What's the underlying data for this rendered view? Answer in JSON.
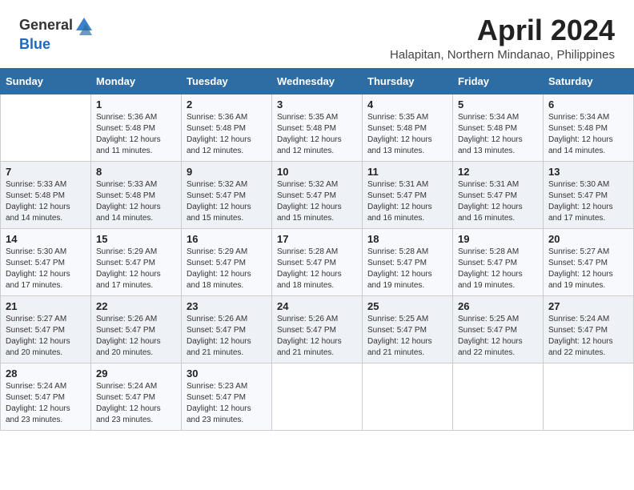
{
  "header": {
    "logo_general": "General",
    "logo_blue": "Blue",
    "title": "April 2024",
    "location": "Halapitan, Northern Mindanao, Philippines"
  },
  "weekdays": [
    "Sunday",
    "Monday",
    "Tuesday",
    "Wednesday",
    "Thursday",
    "Friday",
    "Saturday"
  ],
  "weeks": [
    [
      {
        "date": "",
        "info": ""
      },
      {
        "date": "1",
        "info": "Sunrise: 5:36 AM\nSunset: 5:48 PM\nDaylight: 12 hours and 11 minutes."
      },
      {
        "date": "2",
        "info": "Sunrise: 5:36 AM\nSunset: 5:48 PM\nDaylight: 12 hours and 12 minutes."
      },
      {
        "date": "3",
        "info": "Sunrise: 5:35 AM\nSunset: 5:48 PM\nDaylight: 12 hours and 12 minutes."
      },
      {
        "date": "4",
        "info": "Sunrise: 5:35 AM\nSunset: 5:48 PM\nDaylight: 12 hours and 13 minutes."
      },
      {
        "date": "5",
        "info": "Sunrise: 5:34 AM\nSunset: 5:48 PM\nDaylight: 12 hours and 13 minutes."
      },
      {
        "date": "6",
        "info": "Sunrise: 5:34 AM\nSunset: 5:48 PM\nDaylight: 12 hours and 14 minutes."
      }
    ],
    [
      {
        "date": "7",
        "info": "Sunrise: 5:33 AM\nSunset: 5:48 PM\nDaylight: 12 hours and 14 minutes."
      },
      {
        "date": "8",
        "info": "Sunrise: 5:33 AM\nSunset: 5:48 PM\nDaylight: 12 hours and 14 minutes."
      },
      {
        "date": "9",
        "info": "Sunrise: 5:32 AM\nSunset: 5:47 PM\nDaylight: 12 hours and 15 minutes."
      },
      {
        "date": "10",
        "info": "Sunrise: 5:32 AM\nSunset: 5:47 PM\nDaylight: 12 hours and 15 minutes."
      },
      {
        "date": "11",
        "info": "Sunrise: 5:31 AM\nSunset: 5:47 PM\nDaylight: 12 hours and 16 minutes."
      },
      {
        "date": "12",
        "info": "Sunrise: 5:31 AM\nSunset: 5:47 PM\nDaylight: 12 hours and 16 minutes."
      },
      {
        "date": "13",
        "info": "Sunrise: 5:30 AM\nSunset: 5:47 PM\nDaylight: 12 hours and 17 minutes."
      }
    ],
    [
      {
        "date": "14",
        "info": "Sunrise: 5:30 AM\nSunset: 5:47 PM\nDaylight: 12 hours and 17 minutes."
      },
      {
        "date": "15",
        "info": "Sunrise: 5:29 AM\nSunset: 5:47 PM\nDaylight: 12 hours and 17 minutes."
      },
      {
        "date": "16",
        "info": "Sunrise: 5:29 AM\nSunset: 5:47 PM\nDaylight: 12 hours and 18 minutes."
      },
      {
        "date": "17",
        "info": "Sunrise: 5:28 AM\nSunset: 5:47 PM\nDaylight: 12 hours and 18 minutes."
      },
      {
        "date": "18",
        "info": "Sunrise: 5:28 AM\nSunset: 5:47 PM\nDaylight: 12 hours and 19 minutes."
      },
      {
        "date": "19",
        "info": "Sunrise: 5:28 AM\nSunset: 5:47 PM\nDaylight: 12 hours and 19 minutes."
      },
      {
        "date": "20",
        "info": "Sunrise: 5:27 AM\nSunset: 5:47 PM\nDaylight: 12 hours and 19 minutes."
      }
    ],
    [
      {
        "date": "21",
        "info": "Sunrise: 5:27 AM\nSunset: 5:47 PM\nDaylight: 12 hours and 20 minutes."
      },
      {
        "date": "22",
        "info": "Sunrise: 5:26 AM\nSunset: 5:47 PM\nDaylight: 12 hours and 20 minutes."
      },
      {
        "date": "23",
        "info": "Sunrise: 5:26 AM\nSunset: 5:47 PM\nDaylight: 12 hours and 21 minutes."
      },
      {
        "date": "24",
        "info": "Sunrise: 5:26 AM\nSunset: 5:47 PM\nDaylight: 12 hours and 21 minutes."
      },
      {
        "date": "25",
        "info": "Sunrise: 5:25 AM\nSunset: 5:47 PM\nDaylight: 12 hours and 21 minutes."
      },
      {
        "date": "26",
        "info": "Sunrise: 5:25 AM\nSunset: 5:47 PM\nDaylight: 12 hours and 22 minutes."
      },
      {
        "date": "27",
        "info": "Sunrise: 5:24 AM\nSunset: 5:47 PM\nDaylight: 12 hours and 22 minutes."
      }
    ],
    [
      {
        "date": "28",
        "info": "Sunrise: 5:24 AM\nSunset: 5:47 PM\nDaylight: 12 hours and 23 minutes."
      },
      {
        "date": "29",
        "info": "Sunrise: 5:24 AM\nSunset: 5:47 PM\nDaylight: 12 hours and 23 minutes."
      },
      {
        "date": "30",
        "info": "Sunrise: 5:23 AM\nSunset: 5:47 PM\nDaylight: 12 hours and 23 minutes."
      },
      {
        "date": "",
        "info": ""
      },
      {
        "date": "",
        "info": ""
      },
      {
        "date": "",
        "info": ""
      },
      {
        "date": "",
        "info": ""
      }
    ]
  ]
}
